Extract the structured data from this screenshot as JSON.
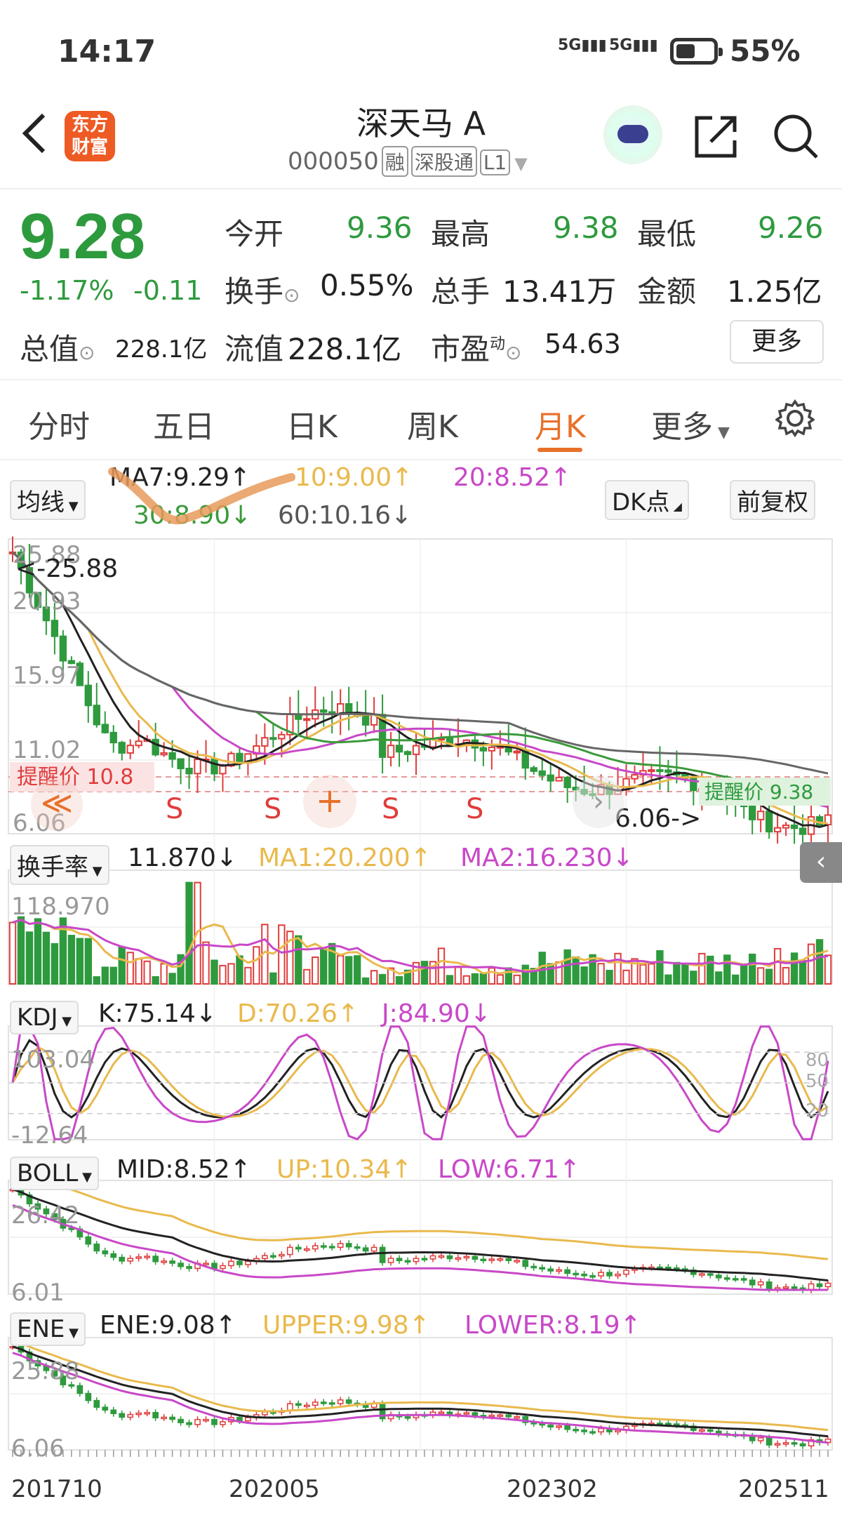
{
  "status": {
    "time": "14:17",
    "signal1": "5G",
    "signal2": "5G",
    "battery": "55%"
  },
  "header": {
    "title": "深天马 A",
    "code": "000050",
    "tags": [
      "融",
      "深股通",
      "L1"
    ],
    "logo_line1": "东方",
    "logo_line2": "财富"
  },
  "quote": {
    "price": "9.28",
    "change_pct": "-1.17%",
    "change": "-0.11",
    "open_label": "今开",
    "open": "9.36",
    "high_label": "最高",
    "high": "9.38",
    "low_label": "最低",
    "low": "9.26",
    "turnover_label": "换手",
    "turnover": "0.55%",
    "volume_label": "总手",
    "volume": "13.41万",
    "amount_label": "金额",
    "amount": "1.25亿",
    "mktcap_label": "总值",
    "mktcap": "228.1亿",
    "float_label": "流值",
    "float": "228.1亿",
    "pe_label": "市盈",
    "pe_sup": "动",
    "pe": "54.63",
    "more": "更多"
  },
  "tabs": [
    "分时",
    "五日",
    "日K",
    "周K",
    "月K",
    "更多"
  ],
  "active_tab": "月K",
  "ma_bar": {
    "selector": "均线",
    "ma7": "MA7:9.29",
    "ma10": "10:9.00",
    "ma20": "20:8.52",
    "ma30": "30:8.90",
    "ma60": "60:10.16",
    "dk": "DK点",
    "adjust": "前复权"
  },
  "main_chart": {
    "y_top": "25.88",
    "y2": "20.93",
    "y3": "15.97",
    "y4": "11.02",
    "y_bottom": "6.06",
    "max_label": "<-25.88",
    "min_label": "6.06->",
    "alert": "提醒价 10.8",
    "alert_right": "提醒价 9.38",
    "signal_s": "S",
    "arrow_left": "≪",
    "plus": "+"
  },
  "turnover_panel": {
    "selector": "换手率",
    "value": "11.870",
    "ma1": "MA1:20.200",
    "ma2": "MA2:16.230",
    "y_top": "118.970"
  },
  "kdj_panel": {
    "selector": "KDJ",
    "k": "K:75.14",
    "d": "D:70.26",
    "j": "J:84.90",
    "y_top": "103.04",
    "y_bottom": "-12.64",
    "r80": "80",
    "r50": "50",
    "r20": "20"
  },
  "boll_panel": {
    "selector": "BOLL",
    "mid": "MID:8.52",
    "up": "UP:10.34",
    "low": "LOW:6.71",
    "y_top": "26.42",
    "y_bottom": "6.01"
  },
  "ene_panel": {
    "selector": "ENE",
    "ene": "ENE:9.08",
    "upper": "UPPER:9.98",
    "lower": "LOWER:8.19",
    "y_top": "25.88",
    "y_bottom": "6.06"
  },
  "x_axis": [
    "201710",
    "202005",
    "202302",
    "202511"
  ],
  "colors": {
    "up": "#e03c3c",
    "down": "#2e9a3e",
    "accent": "#e8702a",
    "ma_yellow": "#e9b94c",
    "ma_purple": "#c848c8"
  }
}
